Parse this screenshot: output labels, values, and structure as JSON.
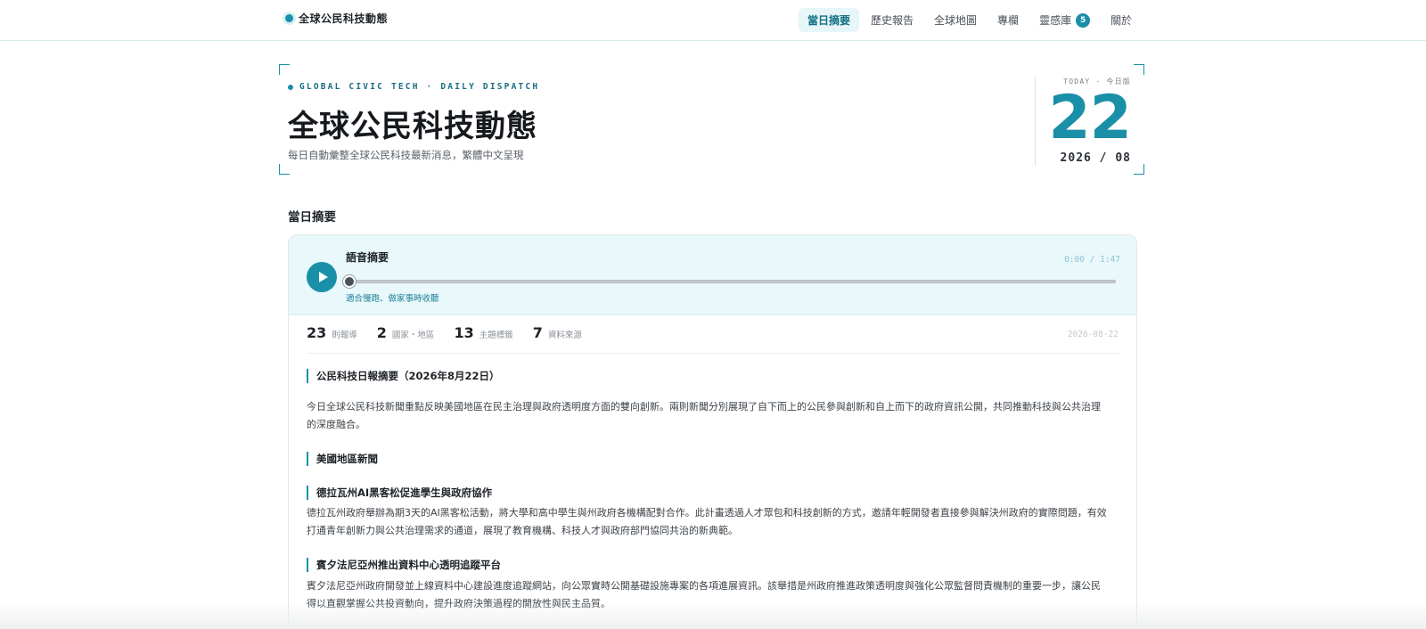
{
  "brand": {
    "name": "全球公民科技動態"
  },
  "nav": {
    "items": [
      {
        "label": "當日摘要",
        "active": true
      },
      {
        "label": "歷史報告",
        "active": false
      },
      {
        "label": "全球地圖",
        "active": false
      },
      {
        "label": "專欄",
        "active": false
      },
      {
        "label": "靈感庫",
        "active": false,
        "badge": "5"
      },
      {
        "label": "關於",
        "active": false
      }
    ]
  },
  "hero": {
    "kicker": "GLOBAL CIVIC TECH · DAILY DISPATCH",
    "title": "全球公民科技動態",
    "subtitle": "每日自動彙整全球公民科技最新消息，繁體中文呈現",
    "today_label": "TODAY · 今日版",
    "day": "22",
    "month_year": "2026 / 08"
  },
  "section_title": "當日摘要",
  "audio": {
    "title": "語音摘要",
    "time": "0:00 / 1:47",
    "note": "適合慢跑、做家事時收聽",
    "progress": 0
  },
  "stats": {
    "items": [
      {
        "num": "23",
        "label": "則報導"
      },
      {
        "num": "2",
        "label": "國家・地區"
      },
      {
        "num": "13",
        "label": "主題標籤"
      },
      {
        "num": "7",
        "label": "資料來源"
      }
    ],
    "date": "2026-08-22"
  },
  "summary": {
    "heading": "公民科技日報摘要（2026年8月22日）",
    "intro": "今日全球公民科技新聞重點反映美國地區在民主治理與政府透明度方面的雙向創新。兩則新聞分別展現了自下而上的公民參與創新和自上而下的政府資訊公開，共同推動科技與公共治理的深度融合。",
    "region_heading": "美國地區新聞",
    "articles": [
      {
        "title": "德拉瓦州AI黑客松促進學生與政府協作",
        "body": "德拉瓦州政府舉辦為期3天的AI黑客松活動，將大學和高中學生與州政府各機構配對合作。此計畫透過人才眾包和科技創新的方式，邀請年輕開發者直接參與解決州政府的實際問題，有效打通青年創新力與公共治理需求的通道，展現了教育機構、科技人才與政府部門協同共治的新典範。"
      },
      {
        "title": "賓夕法尼亞州推出資料中心透明追蹤平台",
        "body": "賓夕法尼亞州政府開發並上線資料中心建設進度追蹤網站，向公眾實時公開基礎設施專案的各項進展資訊。該舉措是州政府推進政策透明度與強化公眾監督問責機制的重要一步，讓公民得以直觀掌握公共投資動向，提升政府決策過程的開放性與民主品質。"
      }
    ]
  }
}
